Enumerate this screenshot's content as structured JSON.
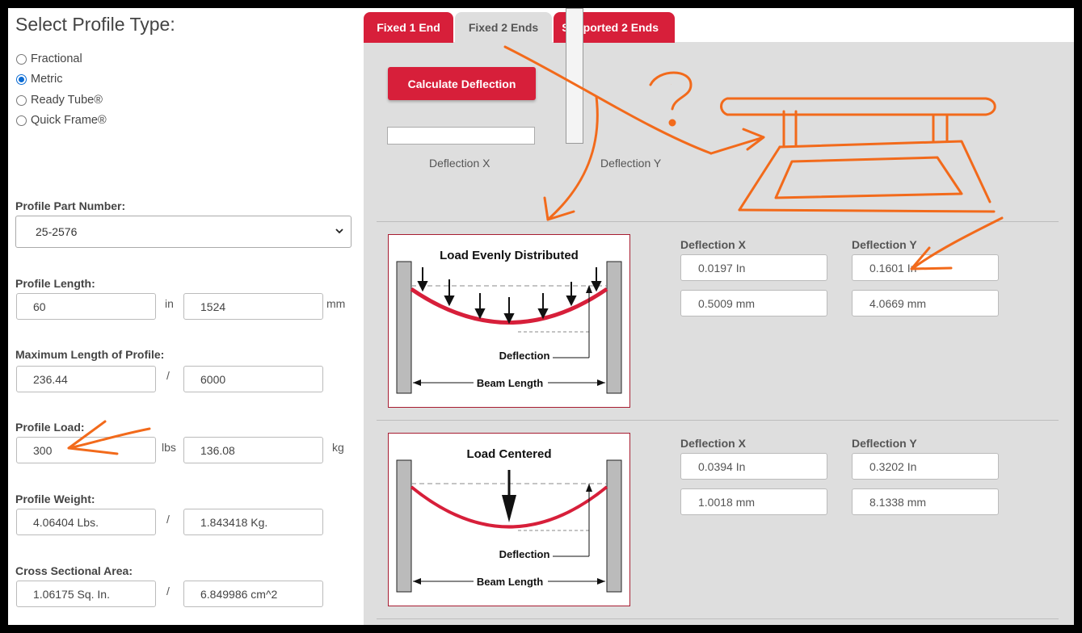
{
  "left": {
    "title": "Select Profile Type:",
    "profile_types": [
      {
        "label": "Fractional",
        "checked": false
      },
      {
        "label": "Metric",
        "checked": true
      },
      {
        "label": "Ready Tube®",
        "checked": false
      },
      {
        "label": "Quick Frame®",
        "checked": false
      }
    ],
    "part_number": {
      "label": "Profile Part Number:",
      "value": "25-2576"
    },
    "length": {
      "label": "Profile Length:",
      "value_in": "60",
      "unit_in": "in",
      "value_mm": "1524",
      "unit_mm": "mm"
    },
    "max_length": {
      "label": "Maximum Length of Profile:",
      "value_a": "236.44",
      "sep": "/",
      "value_b": "6000"
    },
    "load": {
      "label": "Profile Load:",
      "value_lbs": "300",
      "unit_lbs": "lbs",
      "value_kg": "136.08",
      "unit_kg": "kg"
    },
    "weight": {
      "label": "Profile Weight:",
      "value_a": "4.06404 Lbs.",
      "sep": "/",
      "value_b": "1.843418 Kg."
    },
    "area": {
      "label": "Cross Sectional Area:",
      "value_a": "1.06175 Sq. In.",
      "sep": "/",
      "value_b": "6.849986 cm^2"
    }
  },
  "tabs": [
    {
      "label": "Fixed 1 End",
      "active": false
    },
    {
      "label": "Fixed 2 Ends",
      "active": true
    },
    {
      "label": "Supported 2 Ends",
      "active": false
    }
  ],
  "calculate_label": "Calculate Deflection",
  "top_labels": {
    "x": "Deflection X",
    "y": "Deflection Y"
  },
  "cases": [
    {
      "diagram_title": "Load Evenly Distributed",
      "deflection_label": "Deflection",
      "beam_length_label": "Beam Length",
      "x_label": "Deflection X",
      "y_label": "Deflection Y",
      "x_in": "0.0197 In",
      "x_mm": "0.5009 mm",
      "y_in": "0.1601 In",
      "y_mm": "4.0669 mm"
    },
    {
      "diagram_title": "Load Centered",
      "deflection_label": "Deflection",
      "beam_length_label": "Beam Length",
      "x_label": "Deflection X",
      "y_label": "Deflection Y",
      "x_in": "0.0394 In",
      "x_mm": "1.0018 mm",
      "y_in": "0.3202 In",
      "y_mm": "8.1338 mm"
    }
  ],
  "annotation": {
    "question_mark": "?"
  },
  "colors": {
    "accent_red": "#d71f3a",
    "annotation_orange": "#f26a1b",
    "panel_gray": "#dedede"
  }
}
